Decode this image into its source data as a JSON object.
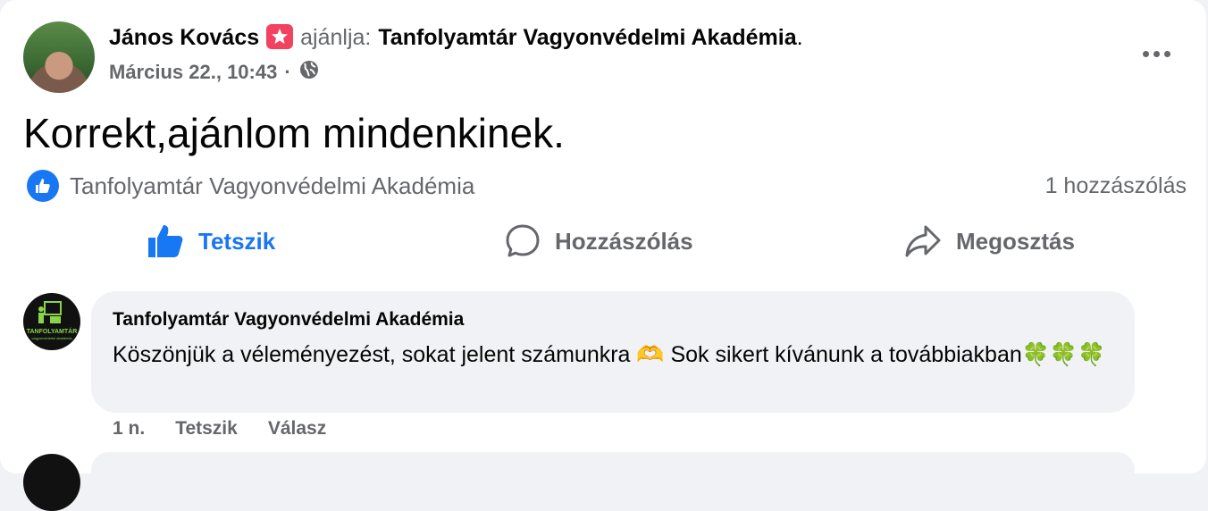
{
  "post": {
    "author": "János Kovács",
    "recommend_verb": "ajánlja:",
    "page": "Tanfolyamtár Vagyonvédelmi Akadémia",
    "period": ".",
    "date": "Március 22., 10:43",
    "separator": "·",
    "privacy_icon": "globe-icon",
    "body": "Korrekt,ajánlom mindenkinek."
  },
  "reactions": {
    "liked_by": "Tanfolyamtár Vagyonvédelmi Akadémia",
    "comment_count": "1 hozzászólás"
  },
  "actions": {
    "like": "Tetszik",
    "comment": "Hozzászólás",
    "share": "Megosztás"
  },
  "comment": {
    "author": "Tanfolyamtár Vagyonvédelmi Akadémia",
    "text": "Köszönjük a véleményezést, sokat jelent számunkra 🫶 Sok sikert kívánunk a továbbiakban🍀🍀🍀",
    "avatar_text": "TANFOLYAMTÁR",
    "avatar_subtext": "vagyonvédelmi akadémia",
    "time": "1 n.",
    "like": "Tetszik",
    "reply": "Válasz"
  },
  "colors": {
    "accent": "#1877f2",
    "muted": "#65676b",
    "badge": "#f3425f",
    "bubble": "#f0f2f5"
  }
}
